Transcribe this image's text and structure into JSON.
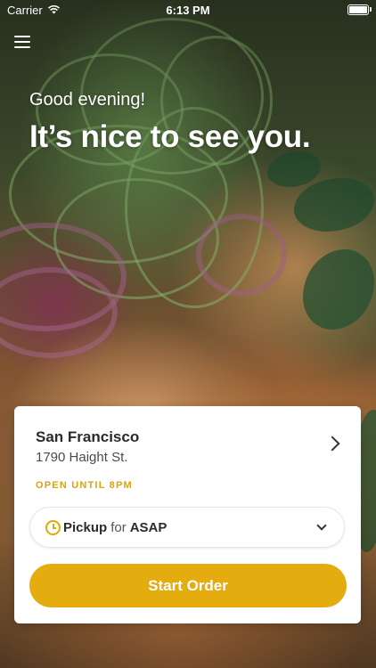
{
  "status_bar": {
    "carrier": "Carrier",
    "time": "6:13 PM",
    "battery_level": 1.0
  },
  "header": {
    "greeting": "Good evening!",
    "welcome": "It’s nice to see you.",
    "menu_icon": "hamburger-menu-icon"
  },
  "location_card": {
    "city": "San Francisco",
    "address": "1790 Haight St.",
    "hours": "OPEN UNTIL 8PM",
    "pickup": {
      "method": "Pickup",
      "joiner": "for",
      "time": "ASAP"
    },
    "start_order_label": "Start Order"
  },
  "colors": {
    "accent": "#E5AC10",
    "hours_text": "#D9A40C",
    "card_background": "#FFFFFF"
  }
}
